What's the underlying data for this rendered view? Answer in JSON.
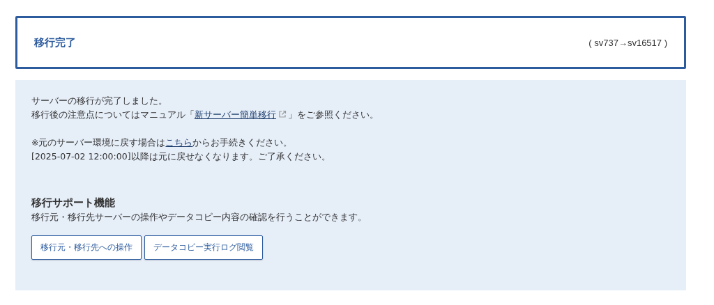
{
  "header": {
    "title": "移行完了",
    "servers": "( sv737→sv16517 )"
  },
  "notice": {
    "paragraphs": [
      {
        "lines": [
          [
            {
              "text": "サーバーの移行が完了しました。"
            }
          ],
          [
            {
              "text": "移行後の注意点についてはマニュアル「"
            },
            {
              "text": "新サーバー簡単移行",
              "kind": "external-link"
            },
            {
              "text": "」をご参照ください。"
            }
          ]
        ]
      },
      {
        "lines": [
          [
            {
              "text": "※元のサーバー環境に戻す場合は"
            },
            {
              "text": "こちら",
              "kind": "link"
            },
            {
              "text": "からお手続きください。"
            }
          ],
          [
            {
              "text": "[2025-07-02 12:00:00]以降は元に戻せなくなります。ご了承ください。"
            }
          ]
        ]
      }
    ]
  },
  "support": {
    "title": "移行サポート機能",
    "description": "移行元・移行先サーバーの操作やデータコピー内容の確認を行うことができます。",
    "buttons": [
      "移行元・移行先への操作",
      "データコピー実行ログ閲覧"
    ]
  }
}
